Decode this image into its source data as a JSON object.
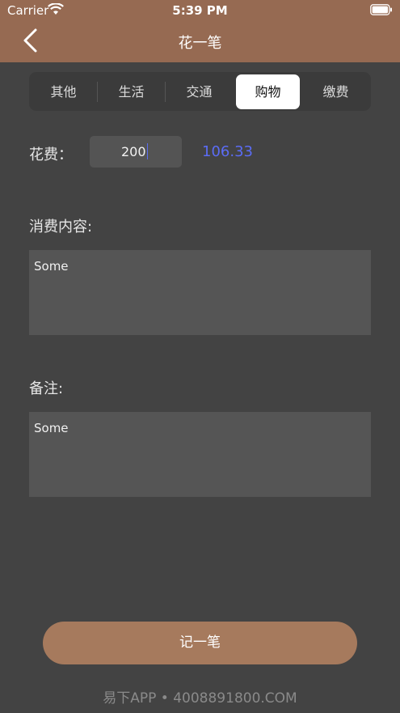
{
  "status_bar": {
    "carrier": "Carrier",
    "time": "5:39 PM"
  },
  "nav": {
    "title": "花一笔",
    "back_icon": "chevron-left-icon"
  },
  "categories": {
    "items": [
      "其他",
      "生活",
      "交通",
      "购物",
      "缴费"
    ],
    "selected": "购物"
  },
  "form": {
    "amount_label": "花费：",
    "amount_value": "200",
    "converted_value": "106.33",
    "content_label": "消费内容:",
    "content_value": "Some",
    "note_label": "备注:",
    "note_value": "Some"
  },
  "submit_label": "记一笔",
  "watermark": "易下APP • 4008891800.COM",
  "colors": {
    "header": "#966a52",
    "background": "#434343",
    "accent": "#5b6cf5",
    "button": "#a67a5d"
  }
}
